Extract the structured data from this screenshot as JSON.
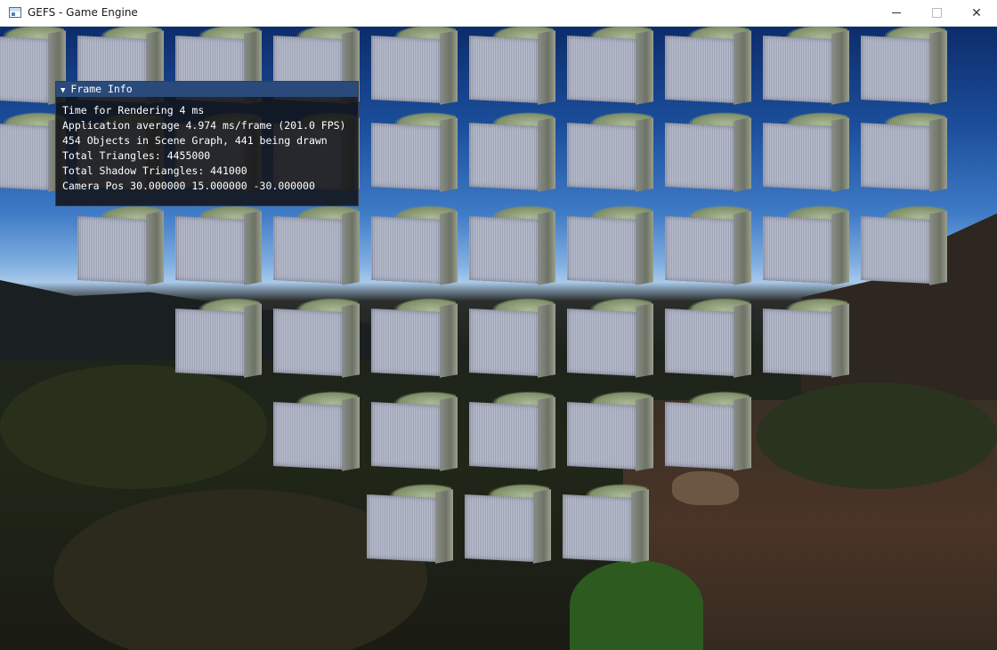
{
  "window": {
    "title": "GEFS - Game Engine",
    "app_icon": "app-window-icon",
    "controls": {
      "minimize_icon": "minimize-icon",
      "maximize_icon": "maximize-icon",
      "close_icon": "close-icon",
      "close_glyph": "✕"
    }
  },
  "frame_info": {
    "title": "Frame Info",
    "collapse_glyph": "▼",
    "lines": [
      "Time for Rendering 4 ms",
      "Application average 4.974 ms/frame (201.0 FPS)",
      "454 Objects in Scene Graph, 441 being drawn",
      "Total Triangles: 4455000",
      "Total Shadow Triangles: 441000",
      "Camera Pos 30.000000 15.000000 -30.000000"
    ]
  },
  "scene": {
    "cube_rows": [
      10,
      10,
      9,
      7,
      5,
      3
    ]
  }
}
